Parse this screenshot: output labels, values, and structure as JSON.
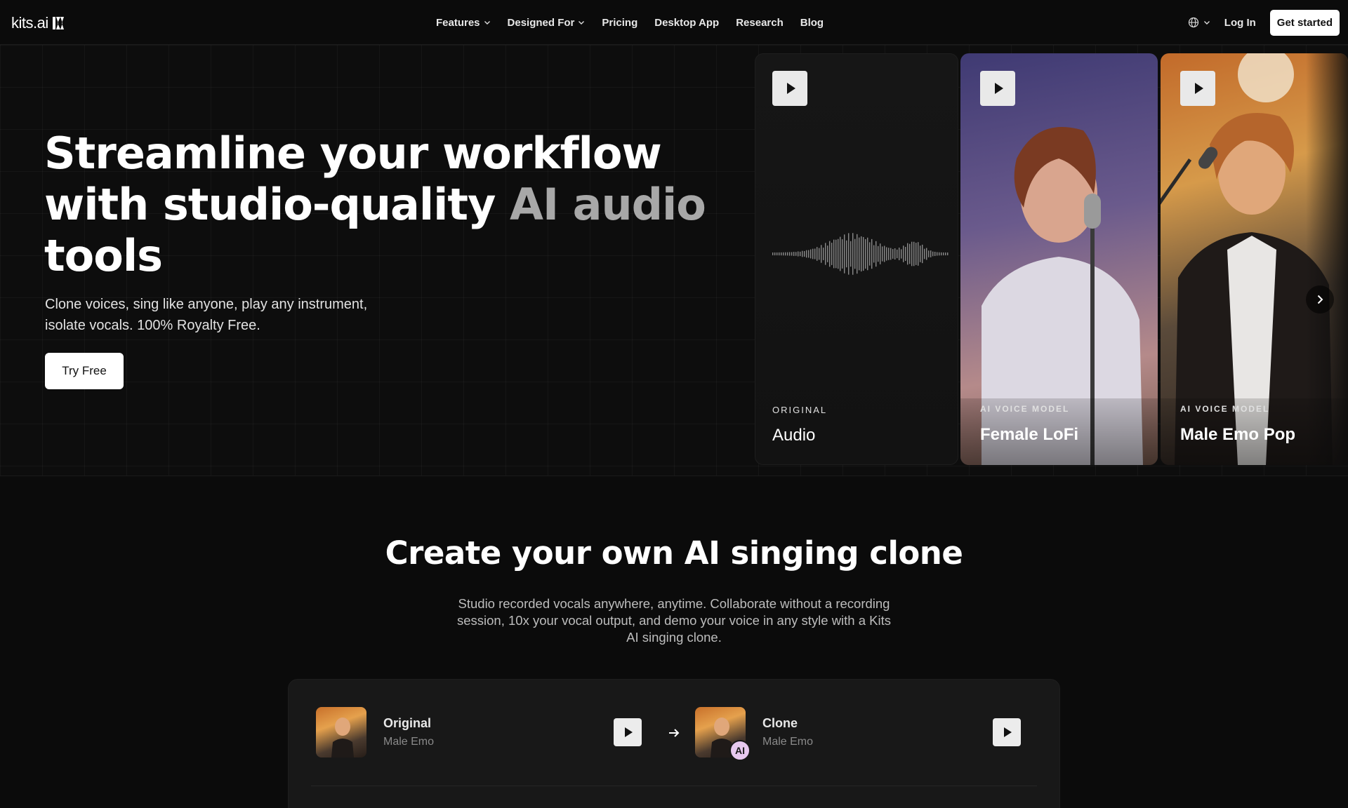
{
  "nav": {
    "logo_text": "kits.ai",
    "links": [
      {
        "label": "Features",
        "dropdown": true
      },
      {
        "label": "Designed For",
        "dropdown": true
      },
      {
        "label": "Pricing",
        "dropdown": false
      },
      {
        "label": "Desktop App",
        "dropdown": false
      },
      {
        "label": "Research",
        "dropdown": false
      },
      {
        "label": "Blog",
        "dropdown": false
      }
    ],
    "login_label": "Log In",
    "cta_label": "Get started",
    "language_icon": "globe-icon"
  },
  "hero": {
    "title_line1": "Streamline your workflow",
    "title_line2_a": "with studio-quality ",
    "title_line2_b": "AI audio",
    "title_line3": "tools",
    "subtitle": "Clone voices, sing like anyone, play any instrument, isolate vocals. 100% Royalty Free.",
    "cta_label": "Try Free"
  },
  "cards": [
    {
      "kicker": "ORIGINAL",
      "name": "Audio"
    },
    {
      "kicker": "AI VOICE MODEL",
      "name": "Female LoFi"
    },
    {
      "kicker": "AI VOICE MODEL",
      "name": "Male Emo Pop"
    }
  ],
  "section2": {
    "title": "Create your own AI singing clone",
    "subtitle": "Studio recorded vocals anywhere, anytime. Collaborate without a recording session, 10x your vocal output, and demo your voice in any style with a Kits AI singing clone.",
    "original": {
      "label": "Original",
      "sub": "Male Emo"
    },
    "clone": {
      "label": "Clone",
      "sub": "Male Emo",
      "badge": "AI"
    }
  },
  "colors": {
    "background": "#0b0b0b",
    "panel": "#181818",
    "accent_badge": "#e7c8ef",
    "button_bg": "#ffffff"
  }
}
